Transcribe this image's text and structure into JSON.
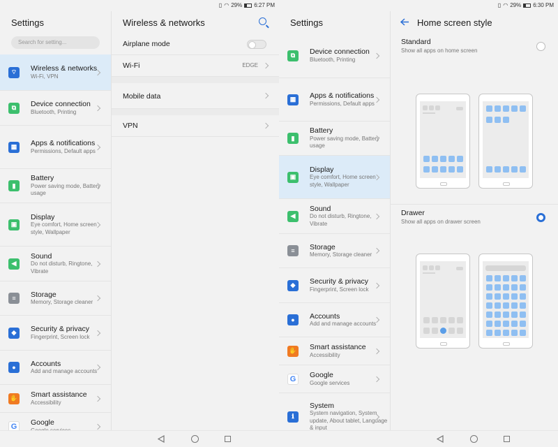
{
  "left": {
    "status": {
      "battery": "29%",
      "time": "6:27 PM"
    },
    "settings_title": "Settings",
    "search_placeholder": "Search for setting...",
    "items": [
      {
        "title": "Wireless & networks",
        "sub": "Wi-Fi, VPN",
        "icon": "wifi-icon",
        "color": "blue",
        "glyph": "⌔"
      },
      {
        "title": "Device connection",
        "sub": "Bluetooth, Printing",
        "icon": "device-connection-icon",
        "color": "green",
        "glyph": "⧉"
      },
      {
        "title": "Apps & notifications",
        "sub": "Permissions, Default apps",
        "icon": "apps-icon",
        "color": "blue",
        "glyph": "▦"
      },
      {
        "title": "Battery",
        "sub": "Power saving mode, Battery usage",
        "icon": "battery-icon",
        "color": "green",
        "glyph": "▮"
      },
      {
        "title": "Display",
        "sub": "Eye comfort, Home screen style, Wallpaper",
        "icon": "display-icon",
        "color": "green",
        "glyph": "▣"
      },
      {
        "title": "Sound",
        "sub": "Do not disturb, Ringtone, Vibrate",
        "icon": "sound-icon",
        "color": "green",
        "glyph": "◀"
      },
      {
        "title": "Storage",
        "sub": "Memory, Storage cleaner",
        "icon": "storage-icon",
        "color": "gray",
        "glyph": "≡"
      },
      {
        "title": "Security & privacy",
        "sub": "Fingerprint, Screen lock",
        "icon": "shield-icon",
        "color": "blue",
        "glyph": "◆"
      },
      {
        "title": "Accounts",
        "sub": "Add and manage accounts",
        "icon": "accounts-icon",
        "color": "blue",
        "glyph": "●"
      },
      {
        "title": "Smart assistance",
        "sub": "Accessibility",
        "icon": "hand-icon",
        "color": "orange",
        "glyph": "✋"
      },
      {
        "title": "Google",
        "sub": "Google services",
        "icon": "google-icon",
        "color": "google",
        "glyph": "G"
      }
    ],
    "wn": {
      "title": "Wireless & networks",
      "airplane": "Airplane mode",
      "wifi": "Wi-Fi",
      "wifi_value": "EDGE",
      "mobile": "Mobile data",
      "vpn": "VPN"
    }
  },
  "right": {
    "status": {
      "battery": "29%",
      "time": "6:30 PM"
    },
    "settings_title": "Settings",
    "items": [
      {
        "title": "Device connection",
        "sub": "Bluetooth, Printing",
        "icon": "device-connection-icon",
        "color": "green",
        "glyph": "⧉"
      },
      {
        "title": "Apps & notifications",
        "sub": "Permissions, Default apps",
        "icon": "apps-icon",
        "color": "blue",
        "glyph": "▦"
      },
      {
        "title": "Battery",
        "sub": "Power saving mode, Battery usage",
        "icon": "battery-icon",
        "color": "green",
        "glyph": "▮"
      },
      {
        "title": "Display",
        "sub": "Eye comfort, Home screen style, Wallpaper",
        "icon": "display-icon",
        "color": "green",
        "glyph": "▣"
      },
      {
        "title": "Sound",
        "sub": "Do not disturb, Ringtone, Vibrate",
        "icon": "sound-icon",
        "color": "green",
        "glyph": "◀"
      },
      {
        "title": "Storage",
        "sub": "Memory, Storage cleaner",
        "icon": "storage-icon",
        "color": "gray",
        "glyph": "≡"
      },
      {
        "title": "Security & privacy",
        "sub": "Fingerprint, Screen lock",
        "icon": "shield-icon",
        "color": "blue",
        "glyph": "◆"
      },
      {
        "title": "Accounts",
        "sub": "Add and manage accounts",
        "icon": "accounts-icon",
        "color": "blue",
        "glyph": "●"
      },
      {
        "title": "Smart assistance",
        "sub": "Accessibility",
        "icon": "hand-icon",
        "color": "orange",
        "glyph": "✋"
      },
      {
        "title": "Google",
        "sub": "Google services",
        "icon": "google-icon",
        "color": "google",
        "glyph": "G"
      },
      {
        "title": "System",
        "sub": "System navigation, System update, About tablet, Language & input",
        "icon": "system-icon",
        "color": "blue",
        "glyph": "ℹ"
      }
    ],
    "hs": {
      "title": "Home screen style",
      "standard_title": "Standard",
      "standard_sub": "Show all apps on home screen",
      "drawer_title": "Drawer",
      "drawer_sub": "Show all apps on drawer screen",
      "selected": "drawer"
    }
  },
  "accent_color": "#2a6fd6"
}
